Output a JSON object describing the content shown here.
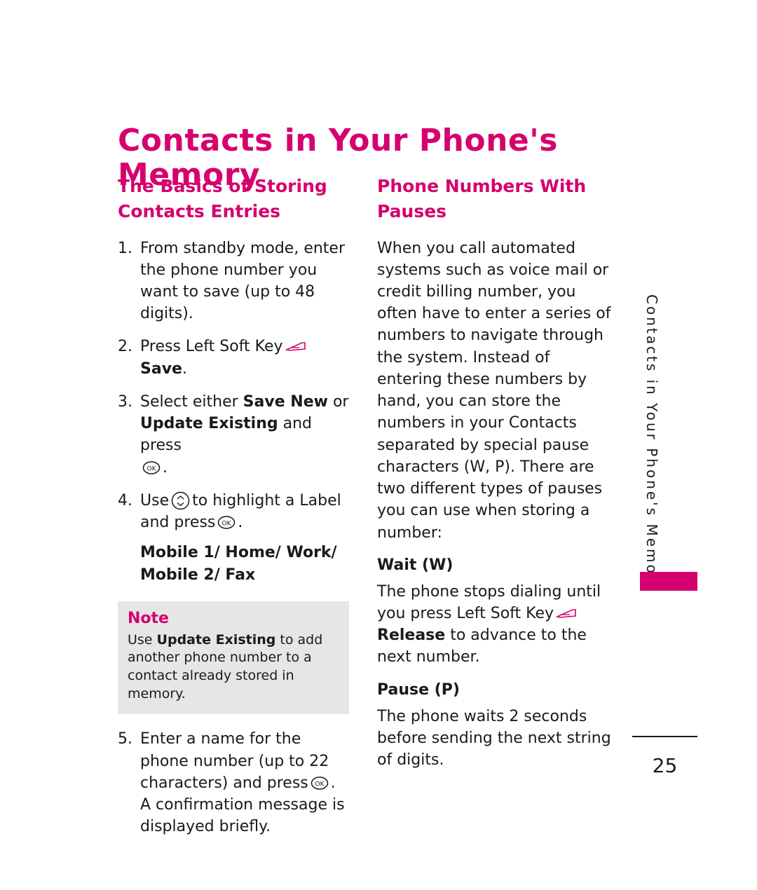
{
  "document": {
    "title": "Contacts in Your Phone's Memory",
    "page_number": "25",
    "side_tab_text": "Contacts in Your Phone's Memory"
  },
  "left_column": {
    "section_heading": "The Basics of Storing Contacts Entries",
    "steps": [
      {
        "number": "1.",
        "text": "From standby mode, enter the phone number you want to save (up to 48 digits)."
      },
      {
        "number": "2.",
        "text_before": "Press Left Soft Key",
        "icon": "soft-key-icon",
        "bold_after": "Save",
        "text_after": "."
      },
      {
        "number": "3.",
        "text_before": "Select either",
        "bold_1": "Save New",
        "text_mid": "or",
        "bold_2": "Update Existing",
        "text_after": "and press",
        "icon": "ok-key-icon",
        "text_end": "."
      },
      {
        "number": "4.",
        "text_before": "Use",
        "icon_nav": "navigation-key-icon",
        "text_mid": "to highlight a Label and press",
        "icon_ok": "ok-key-icon",
        "text_after": ".",
        "labels_line1": "Mobile 1/ Home/ Work/",
        "labels_line2": "Mobile 2/ Fax"
      },
      {
        "number": "5.",
        "text_before": "Enter a name for the phone number (up to 22 characters) and press",
        "icon_ok": "ok-key-icon",
        "text_after": ". A confirmation message is displayed briefly."
      }
    ],
    "note": {
      "title": "Note",
      "text_before": "Use",
      "bold": "Update Existing",
      "text_after": "to add another phone number to a contact already stored in memory."
    }
  },
  "right_column": {
    "section_heading": "Phone Numbers With Pauses",
    "intro": "When you call automated systems such as voice mail or credit billing number, you often have to enter a series of numbers to navigate through the system. Instead of entering these numbers by hand, you can store the numbers in your Contacts separated by special pause characters (W, P). There are two different types of pauses you can use when storing a number:",
    "wait": {
      "heading": "Wait (W)",
      "text_before": "The phone stops dialing until you press Left Soft Key",
      "icon": "soft-key-icon",
      "bold": "Release",
      "text_after": "to advance to the next number."
    },
    "pause": {
      "heading": "Pause (P)",
      "text": "The phone waits 2 seconds before sending the next string of digits."
    }
  },
  "colors": {
    "accent": "#d6006e",
    "body": "#1a1a1a",
    "note_bg": "#e6e6e6"
  }
}
